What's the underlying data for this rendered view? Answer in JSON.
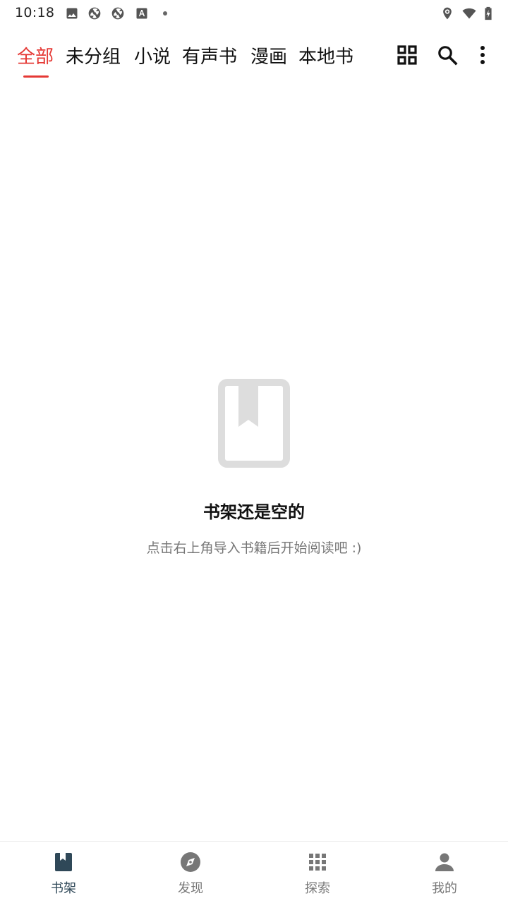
{
  "status_bar": {
    "time": "10:18",
    "left_icons": [
      "image-icon",
      "aperture-icon",
      "aperture-icon",
      "font-icon",
      "dot-icon"
    ],
    "right_icons": [
      "location-icon",
      "wifi-icon",
      "battery-charging-icon"
    ]
  },
  "tabs": [
    {
      "label": "全部",
      "active": true
    },
    {
      "label": "未分组",
      "active": false
    },
    {
      "label": "小说",
      "active": false
    },
    {
      "label": "有声书",
      "active": false
    },
    {
      "label": "漫画",
      "active": false
    },
    {
      "label": "本地书",
      "active": false
    }
  ],
  "toolbar_actions": [
    "grid-layout-icon",
    "search-icon",
    "more-vert-icon"
  ],
  "empty_state": {
    "icon": "book-bookmark-icon",
    "title": "书架还是空的",
    "subtitle": "点击右上角导入书籍后开始阅读吧 :)"
  },
  "bottom_nav": [
    {
      "label": "书架",
      "icon": "book-icon",
      "active": true
    },
    {
      "label": "发现",
      "icon": "compass-icon",
      "active": false
    },
    {
      "label": "探索",
      "icon": "apps-grid-icon",
      "active": false
    },
    {
      "label": "我的",
      "icon": "person-icon",
      "active": false
    }
  ],
  "colors": {
    "accent": "#e53935",
    "nav_active": "#2f4858",
    "nav_inactive": "#777777",
    "empty_icon": "#dddddd"
  }
}
